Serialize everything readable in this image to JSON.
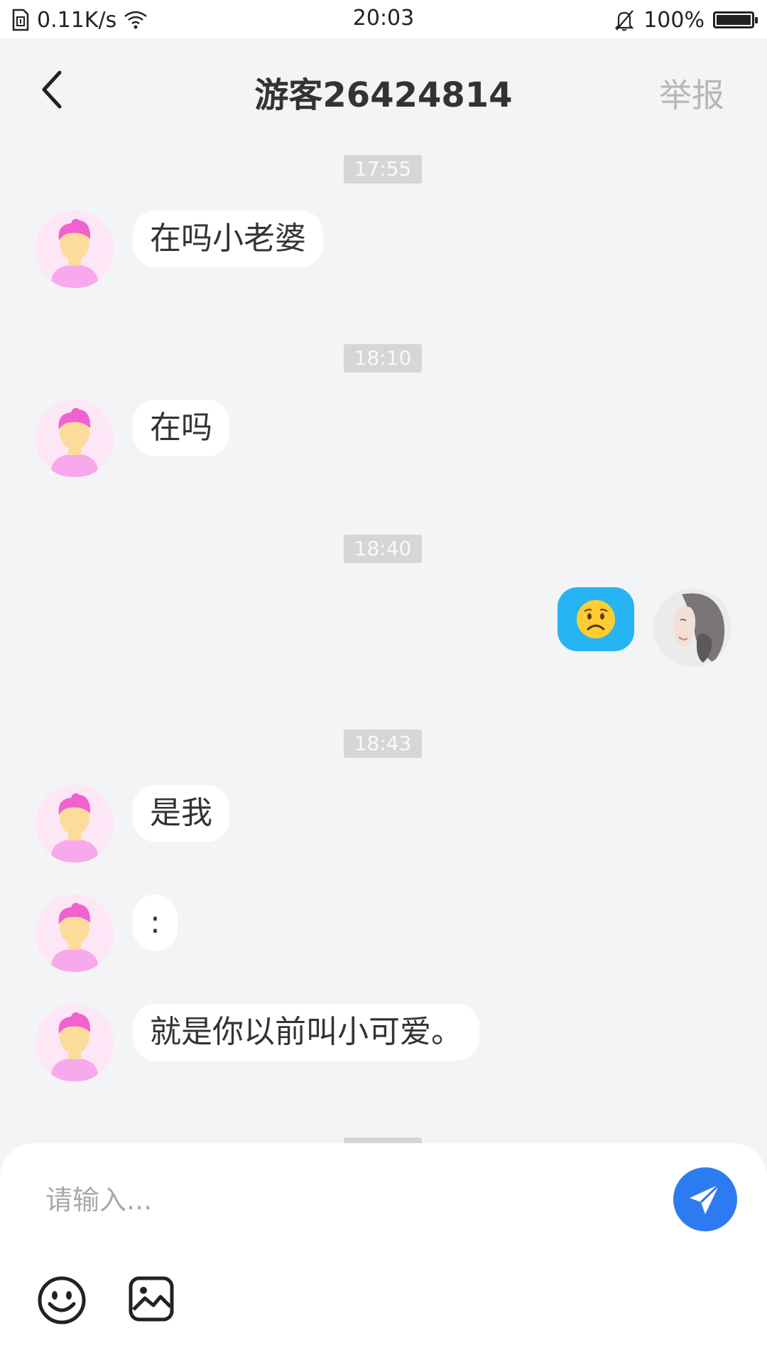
{
  "status_bar": {
    "net_speed": "0.11K/s",
    "time": "20:03",
    "battery": "100%",
    "icons": [
      "sim-card-icon",
      "wifi-icon",
      "bell-off-icon",
      "battery-icon"
    ]
  },
  "header": {
    "title": "游客26424814",
    "report_label": "举报",
    "back_icon": "chevron-left-icon"
  },
  "messages": [
    {
      "time": "17:55",
      "text": "在吗小老婆"
    },
    {
      "time": "18:10",
      "text": "在吗"
    },
    {
      "time": "18:40",
      "emoji": "😟"
    },
    {
      "time": "18:43",
      "text": "是我"
    },
    {
      "text": ":"
    },
    {
      "text": "就是你以前叫小可爱。"
    }
  ],
  "input": {
    "placeholder": "请输入...",
    "value": ""
  },
  "toolbar": {
    "icons": [
      "emoji-icon",
      "image-icon",
      "send-icon"
    ]
  },
  "colors": {
    "background": "#f3f4f6",
    "accent_send": "#2d7bf0",
    "my_bubble": "#27b4f4",
    "avatar_bg": "#fde6f6"
  }
}
